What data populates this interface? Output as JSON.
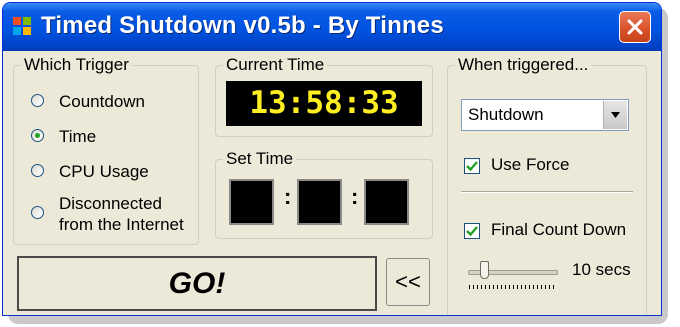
{
  "window": {
    "title": "Timed Shutdown v0.5b - By Tinnes",
    "close_label": "close"
  },
  "trigger_group": {
    "legend": "Which Trigger",
    "options": [
      {
        "label": "Countdown",
        "checked": false
      },
      {
        "label": "Time",
        "checked": true
      },
      {
        "label": "CPU Usage",
        "checked": false
      },
      {
        "label": "Disconnected from the Internet",
        "line1": "Disconnected",
        "line2": "from the Internet",
        "checked": false
      }
    ]
  },
  "current_time": {
    "legend": "Current Time",
    "value": "13:58:33"
  },
  "set_time": {
    "legend": "Set Time",
    "hours": "",
    "minutes": "",
    "seconds": "",
    "separator": ":"
  },
  "actions": {
    "go_label": "GO!",
    "collapse_label": "<<"
  },
  "when_triggered": {
    "legend": "When triggered...",
    "action_selected": "Shutdown",
    "use_force_label": "Use Force",
    "use_force_checked": true,
    "final_countdown_label": "Final Count Down",
    "final_countdown_checked": true,
    "countdown_value": "10 secs",
    "countdown_seconds": 10,
    "slider_fraction": 0.18
  },
  "colors": {
    "titlebar": "#0053e1",
    "lcd_text": "#ffee22",
    "close_button": "#d9502a",
    "window_bg": "#ece9d8"
  }
}
